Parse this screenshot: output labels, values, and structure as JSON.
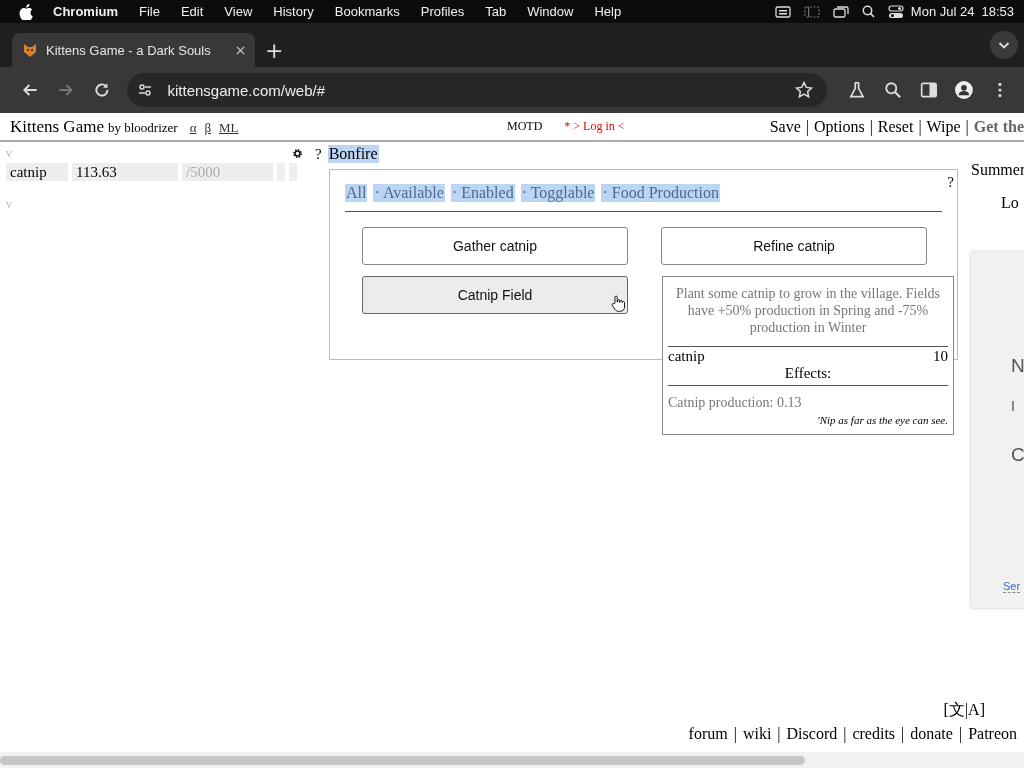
{
  "menubar": {
    "app": "Chromium",
    "menus": [
      "File",
      "Edit",
      "View",
      "History",
      "Bookmarks",
      "Profiles",
      "Tab",
      "Window",
      "Help"
    ],
    "date": "Mon Jul 24",
    "time": "18:53"
  },
  "browser": {
    "tab": {
      "title": "Kittens Game - a Dark Souls",
      "selected": true
    },
    "new_tab": "+",
    "url": "kittensgame.com/web/#"
  },
  "header": {
    "title": "Kittens Game",
    "byline": "by bloodrizer",
    "links": [
      "α",
      "β",
      "ML"
    ],
    "motd": "MOTD",
    "login": "* > Log in <",
    "separator": "|",
    "actions": [
      "Save",
      "Options",
      "Reset",
      "Wipe"
    ],
    "promo": "Get the"
  },
  "resources": {
    "toggles": [
      "v",
      "v"
    ],
    "rows": [
      {
        "name": "catnip",
        "amount": "113.63",
        "max": "/5000"
      }
    ]
  },
  "tabs": {
    "help": "?",
    "items": [
      {
        "label": "Bonfire",
        "selected": true
      }
    ]
  },
  "selection_highlight": true,
  "panel": {
    "help": "?",
    "filters": [
      {
        "label": "All"
      },
      {
        "label": "· Available"
      },
      {
        "label": "· Enabled"
      },
      {
        "label": "· Togglable"
      },
      {
        "label": "· Food Production"
      }
    ],
    "buttons": [
      {
        "label": "Gather catnip",
        "hovered": false
      },
      {
        "label": "Refine catnip",
        "hovered": false
      },
      {
        "label": "Catnip Field",
        "hovered": true
      }
    ]
  },
  "tooltip": {
    "description": "Plant some catnip to grow in the village. Fields have +50% production in Spring and -75% production in Winter",
    "prices": [
      {
        "name": "catnip",
        "amount": "10"
      }
    ],
    "effects_title": "Effects:",
    "effects": [
      "Catnip production: 0.13"
    ],
    "flavor": "'Nip as far as the eye can see."
  },
  "side": {
    "season": "Summer",
    "log": "Lo",
    "card_lines": [
      "N",
      "I",
      "C"
    ],
    "card_link": "Ser"
  },
  "footer": {
    "language": "[文|A]",
    "separator": "|",
    "links": [
      "forum",
      "wiki",
      "Discord",
      "credits",
      "donate",
      "Patreon"
    ]
  }
}
